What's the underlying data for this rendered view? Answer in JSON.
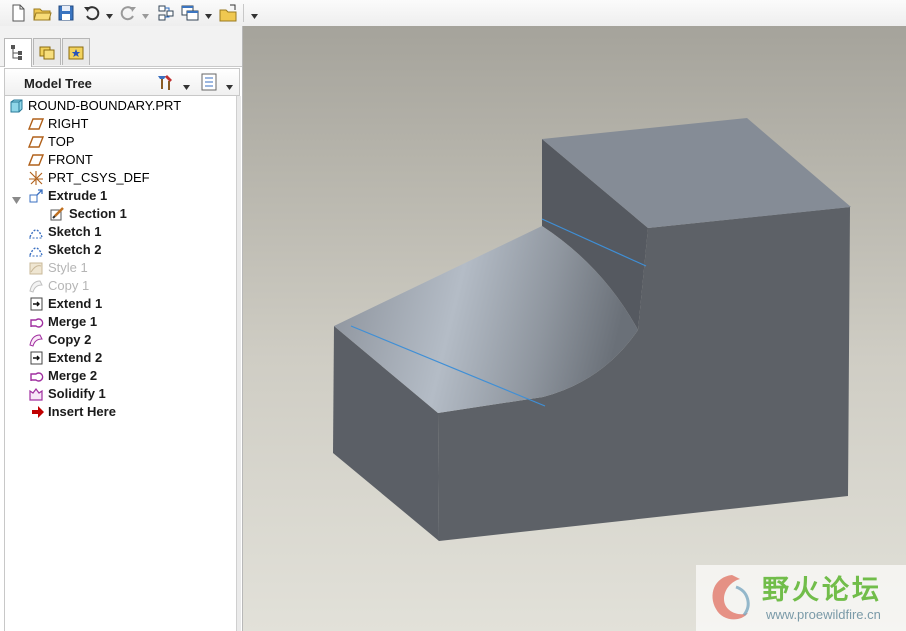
{
  "toolbar": {
    "buttons": [
      "new-file-icon",
      "open-folder-icon",
      "save-icon",
      "undo-icon",
      "redo-icon",
      "regenerate-icon",
      "window-icon",
      "open-folder-icon"
    ],
    "more": "▾"
  },
  "panel_tabs": [
    "model-tree-tab",
    "folder-browser-tab",
    "favorites-tab"
  ],
  "tree_header": {
    "title": "Model Tree",
    "settings_icon": "tools-icon",
    "show_icon": "list-icon"
  },
  "tree": {
    "items": [
      {
        "label": "ROUND-BOUNDARY.PRT",
        "icon": "part-icon",
        "style": "normal"
      },
      {
        "label": "RIGHT",
        "icon": "datum-plane-icon",
        "style": "normal"
      },
      {
        "label": "TOP",
        "icon": "datum-plane-icon",
        "style": "normal"
      },
      {
        "label": "FRONT",
        "icon": "datum-plane-icon",
        "style": "normal"
      },
      {
        "label": "PRT_CSYS_DEF",
        "icon": "csys-icon",
        "style": "normal"
      },
      {
        "label": "Extrude 1",
        "icon": "extrude-icon",
        "style": "bold"
      },
      {
        "label": "Section 1",
        "icon": "section-icon",
        "style": "bold"
      },
      {
        "label": "Sketch 1",
        "icon": "sketch-icon",
        "style": "bold"
      },
      {
        "label": "Sketch 2",
        "icon": "sketch-icon",
        "style": "bold"
      },
      {
        "label": "Style 1",
        "icon": "style-icon",
        "style": "dim"
      },
      {
        "label": "Copy 1",
        "icon": "copy-icon",
        "style": "dim"
      },
      {
        "label": "Extend 1",
        "icon": "extend-icon",
        "style": "bold"
      },
      {
        "label": "Merge 1",
        "icon": "merge-icon",
        "style": "bold"
      },
      {
        "label": "Copy 2",
        "icon": "copy-icon",
        "style": "bold"
      },
      {
        "label": "Extend 2",
        "icon": "extend-icon",
        "style": "bold"
      },
      {
        "label": "Merge 2",
        "icon": "merge-icon",
        "style": "bold"
      },
      {
        "label": "Solidify 1",
        "icon": "solidify-icon",
        "style": "bold"
      },
      {
        "label": "Insert Here",
        "icon": "insert-arrow-icon",
        "style": "bold"
      }
    ]
  },
  "watermark": {
    "title": "野火论坛",
    "url": "www.proewildfire.cn"
  },
  "colors": {
    "model_face": "#5d6167",
    "model_top": "#858c96",
    "edge_highlight": "#3f8fd6",
    "insert_arrow": "#c00000",
    "watermark_green": "#71bd4a"
  }
}
